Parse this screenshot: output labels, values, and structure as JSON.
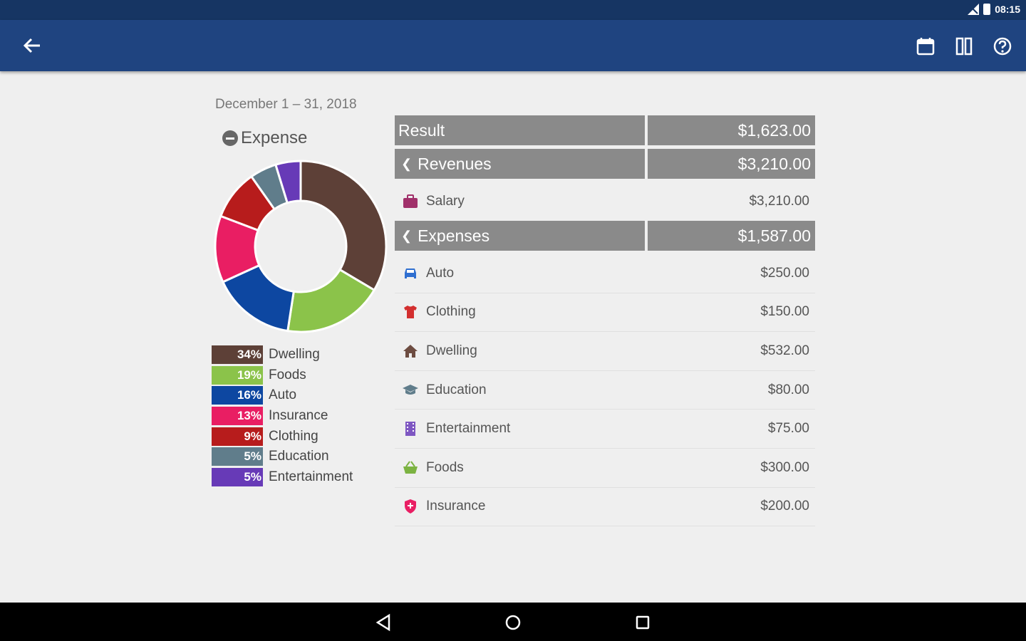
{
  "status": {
    "time": "08:15"
  },
  "period": "December 1 – 31, 2018",
  "expense_title": "Expense",
  "legend": [
    {
      "pct": "34%",
      "name": "Dwelling",
      "color": "#5d4037"
    },
    {
      "pct": "19%",
      "name": "Foods",
      "color": "#8bc34a"
    },
    {
      "pct": "16%",
      "name": "Auto",
      "color": "#0d47a1"
    },
    {
      "pct": "13%",
      "name": "Insurance",
      "color": "#e91e63"
    },
    {
      "pct": "9%",
      "name": "Clothing",
      "color": "#b71c1c"
    },
    {
      "pct": "5%",
      "name": "Education",
      "color": "#607d8b"
    },
    {
      "pct": "5%",
      "name": "Entertainment",
      "color": "#673ab7"
    }
  ],
  "table": {
    "result": {
      "label": "Result",
      "value": "$1,623.00"
    },
    "revenues": {
      "label": "Revenues",
      "value": "$3,210.00"
    },
    "revenue_rows": [
      {
        "label": "Salary",
        "value": "$3,210.00",
        "icon": "briefcase-icon"
      }
    ],
    "expenses": {
      "label": "Expenses",
      "value": "$1,587.00"
    },
    "expense_rows": [
      {
        "label": "Auto",
        "value": "$250.00",
        "icon": "car-icon"
      },
      {
        "label": "Clothing",
        "value": "$150.00",
        "icon": "shirt-icon"
      },
      {
        "label": "Dwelling",
        "value": "$532.00",
        "icon": "home-icon"
      },
      {
        "label": "Education",
        "value": "$80.00",
        "icon": "graduation-cap-icon"
      },
      {
        "label": "Entertainment",
        "value": "$75.00",
        "icon": "film-icon"
      },
      {
        "label": "Foods",
        "value": "$300.00",
        "icon": "basket-icon"
      },
      {
        "label": "Insurance",
        "value": "$200.00",
        "icon": "shield-icon"
      }
    ]
  },
  "chart_data": {
    "type": "pie",
    "title": "Expense",
    "categories": [
      "Dwelling",
      "Foods",
      "Auto",
      "Insurance",
      "Clothing",
      "Education",
      "Entertainment"
    ],
    "values": [
      532,
      300,
      250,
      200,
      150,
      80,
      75
    ],
    "colors": [
      "#5d4037",
      "#8bc34a",
      "#0d47a1",
      "#e91e63",
      "#b71c1c",
      "#607d8b",
      "#673ab7"
    ]
  }
}
